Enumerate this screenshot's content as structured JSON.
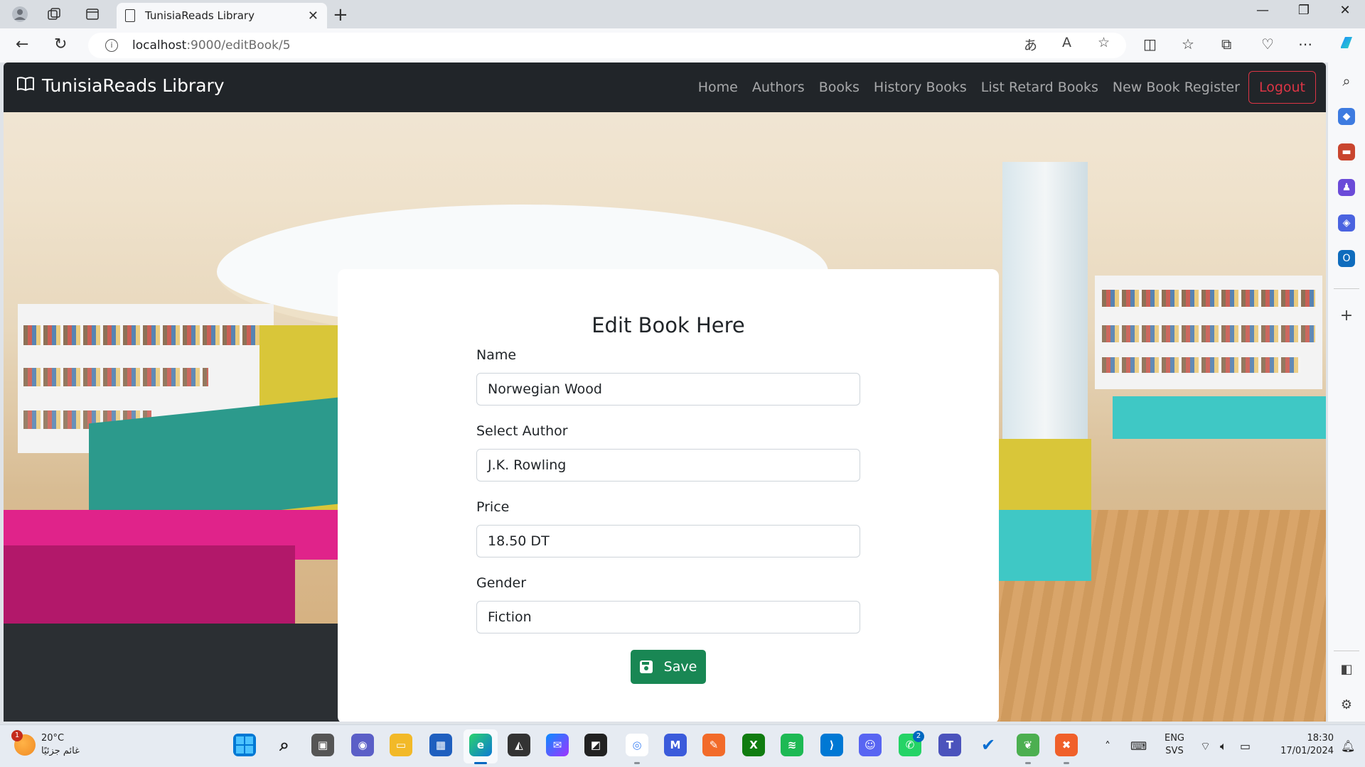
{
  "browser": {
    "tab_title": "TunisiaReads Library",
    "url_host": "localhost",
    "url_path": ":9000/editBook/5"
  },
  "navbar": {
    "brand": "TunisiaReads Library",
    "links": [
      "Home",
      "Authors",
      "Books",
      "History Books",
      "List Retard Books",
      "New Book Register"
    ],
    "logout": "Logout"
  },
  "form": {
    "title": "Edit Book Here",
    "name_label": "Name",
    "name_value": "Norwegian Wood",
    "author_label": "Select Author",
    "author_value": "J.K. Rowling",
    "price_label": "Price",
    "price_value": "18.50 DT",
    "gender_label": "Gender",
    "gender_value": "Fiction",
    "save_label": "Save"
  },
  "taskbar": {
    "weather_temp": "20°C",
    "weather_desc": "غائم جزئيًا",
    "weather_badge": "1",
    "whatsapp_badge": "2",
    "lang_top": "ENG",
    "lang_bottom": "SVS",
    "time": "18:30",
    "date": "17/01/2024"
  },
  "colors": {
    "navbar_bg": "#212529",
    "logout": "#dc3545",
    "save_button": "#198754"
  }
}
